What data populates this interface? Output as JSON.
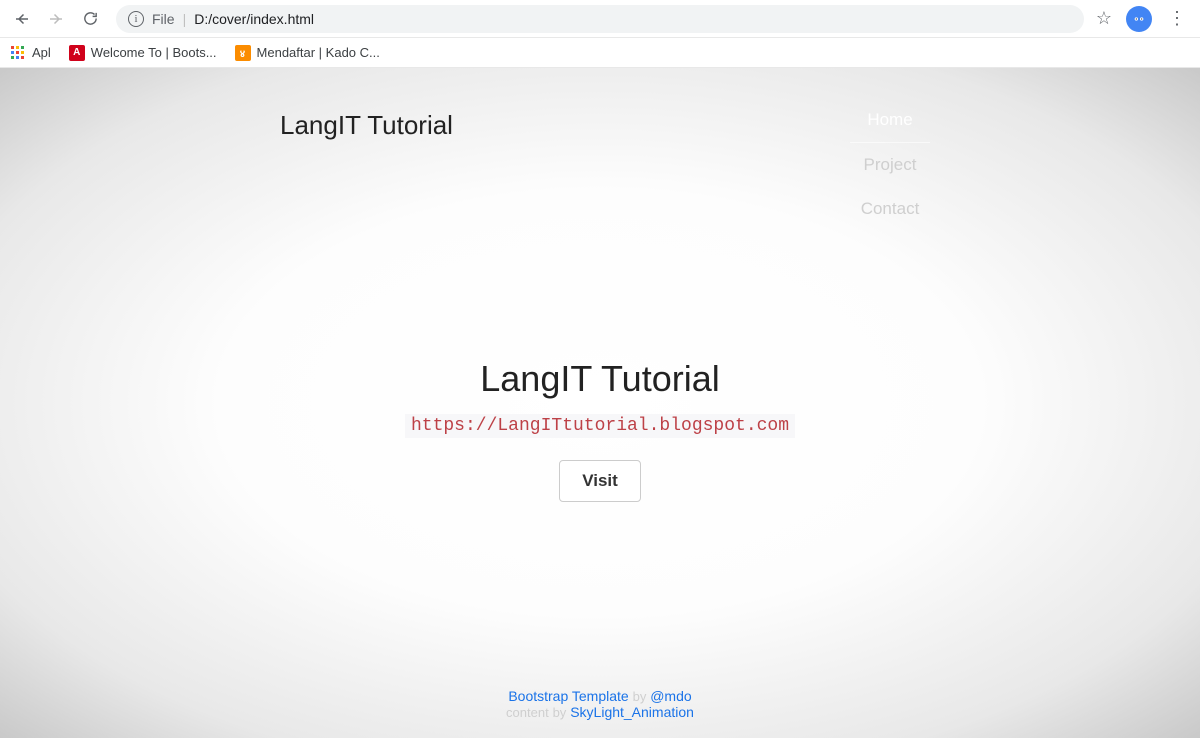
{
  "browser": {
    "address_prefix": "File",
    "address_path": "D:/cover/index.html",
    "bookmarks": {
      "apps": "Apl",
      "b1": "Welcome To | Boots...",
      "b2": "Mendaftar | Kado C..."
    }
  },
  "header": {
    "brand": "LangIT Tutorial",
    "nav": {
      "home": "Home",
      "project": "Project",
      "contact": "Contact"
    }
  },
  "hero": {
    "title": "LangIT Tutorial",
    "url": "https://LangITtutorial.blogspot.com",
    "button": "Visit"
  },
  "footer": {
    "template_label": "Bootstrap Template",
    "by1": "by",
    "author1": "@mdo",
    "content_label": "content",
    "by2": "by",
    "author2": "SkyLight_Animation"
  }
}
